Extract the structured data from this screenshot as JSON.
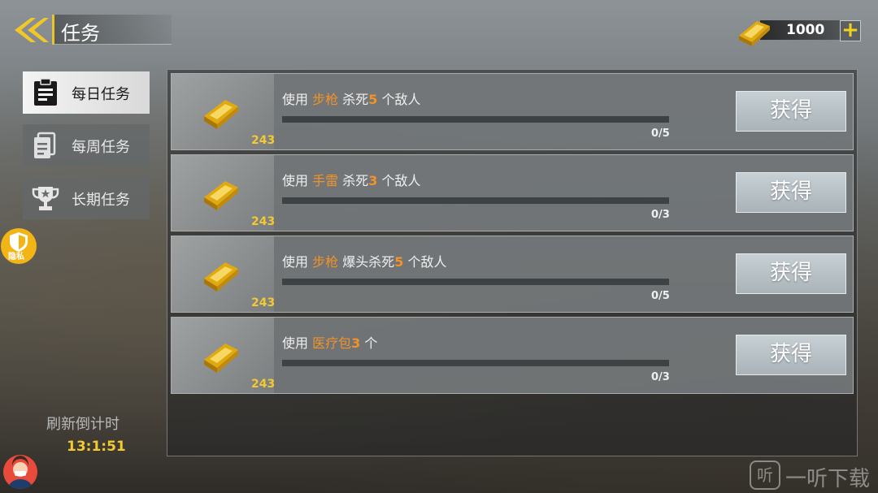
{
  "header": {
    "title": "任务"
  },
  "currency": {
    "amount": "1000",
    "plus": "+",
    "icon": "gold-bar-icon"
  },
  "sidebar": {
    "tabs": [
      {
        "label": "每日任务",
        "icon": "clipboard-icon",
        "active": true
      },
      {
        "label": "每周任务",
        "icon": "document-icon",
        "active": false
      },
      {
        "label": "长期任务",
        "icon": "trophy-icon",
        "active": false
      }
    ],
    "privacy": "隐私",
    "refresh_label": "刷新倒计时",
    "refresh_time": "13:1:51"
  },
  "tasks": [
    {
      "reward": "243",
      "prefix": "使用",
      "item": "步枪",
      "action": "杀死",
      "count": "5",
      "suffix": "个敌人",
      "progress_text": "0/5",
      "progress": 0,
      "button": "获得"
    },
    {
      "reward": "243",
      "prefix": "使用",
      "item": "手雷",
      "action": "杀死",
      "count": "3",
      "suffix": "个敌人",
      "progress_text": "0/3",
      "progress": 0,
      "button": "获得"
    },
    {
      "reward": "243",
      "prefix": "使用",
      "item": "步枪",
      "action": "爆头杀死",
      "count": "5",
      "suffix": "个敌人",
      "progress_text": "0/5",
      "progress": 0,
      "button": "获得"
    },
    {
      "reward": "243",
      "prefix": "使用",
      "item": "医疗包",
      "action": "",
      "count": "3",
      "suffix": "个",
      "progress_text": "0/3",
      "progress": 0,
      "button": "获得"
    }
  ],
  "watermark": {
    "icon_text": "听",
    "text": "一听下载"
  },
  "colors": {
    "gold": "#f2c930",
    "highlight": "#f29227",
    "accent": "#e8c62a"
  }
}
